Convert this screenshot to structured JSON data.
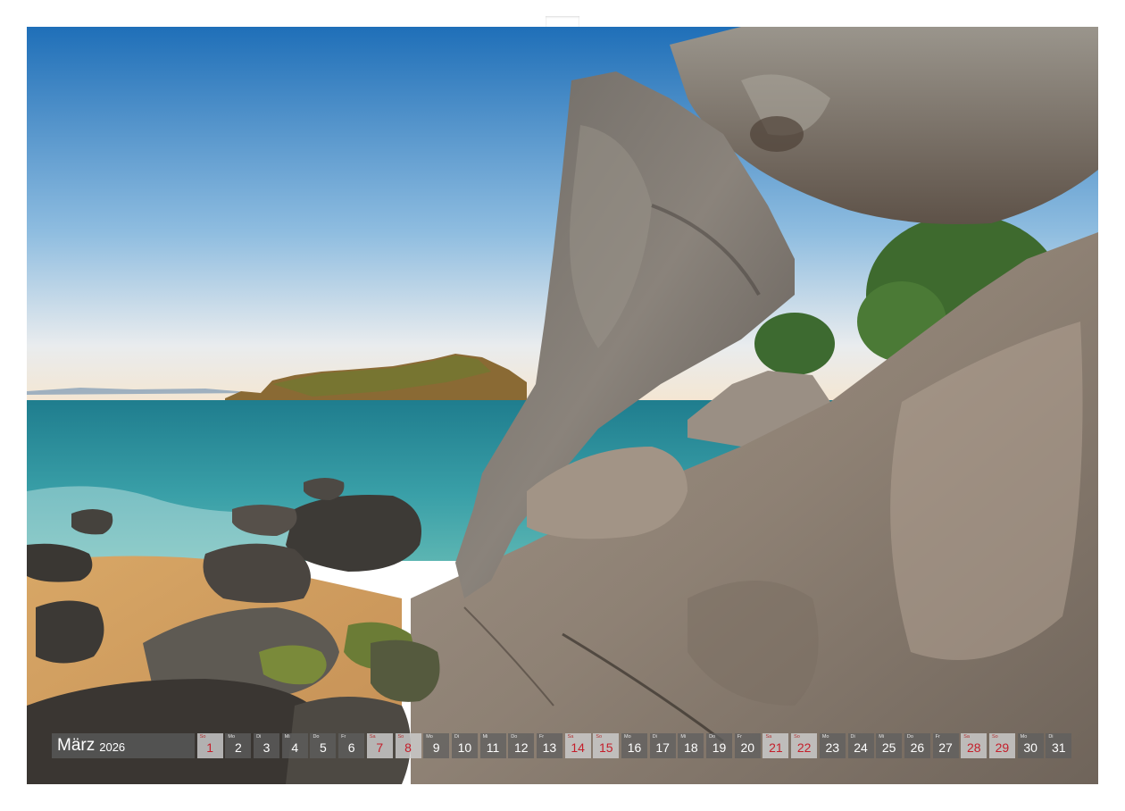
{
  "calendar": {
    "month": "März",
    "year": "2026",
    "days": [
      {
        "wd": "So",
        "num": "1",
        "hol": true
      },
      {
        "wd": "Mo",
        "num": "2",
        "hol": false
      },
      {
        "wd": "Di",
        "num": "3",
        "hol": false
      },
      {
        "wd": "Mi",
        "num": "4",
        "hol": false
      },
      {
        "wd": "Do",
        "num": "5",
        "hol": false
      },
      {
        "wd": "Fr",
        "num": "6",
        "hol": false
      },
      {
        "wd": "Sa",
        "num": "7",
        "hol": true
      },
      {
        "wd": "So",
        "num": "8",
        "hol": true
      },
      {
        "wd": "Mo",
        "num": "9",
        "hol": false
      },
      {
        "wd": "Di",
        "num": "10",
        "hol": false
      },
      {
        "wd": "Mi",
        "num": "11",
        "hol": false
      },
      {
        "wd": "Do",
        "num": "12",
        "hol": false
      },
      {
        "wd": "Fr",
        "num": "13",
        "hol": false
      },
      {
        "wd": "Sa",
        "num": "14",
        "hol": true
      },
      {
        "wd": "So",
        "num": "15",
        "hol": true
      },
      {
        "wd": "Mo",
        "num": "16",
        "hol": false
      },
      {
        "wd": "Di",
        "num": "17",
        "hol": false
      },
      {
        "wd": "Mi",
        "num": "18",
        "hol": false
      },
      {
        "wd": "Do",
        "num": "19",
        "hol": false
      },
      {
        "wd": "Fr",
        "num": "20",
        "hol": false
      },
      {
        "wd": "Sa",
        "num": "21",
        "hol": true
      },
      {
        "wd": "So",
        "num": "22",
        "hol": true
      },
      {
        "wd": "Mo",
        "num": "23",
        "hol": false
      },
      {
        "wd": "Di",
        "num": "24",
        "hol": false
      },
      {
        "wd": "Mi",
        "num": "25",
        "hol": false
      },
      {
        "wd": "Do",
        "num": "26",
        "hol": false
      },
      {
        "wd": "Fr",
        "num": "27",
        "hol": false
      },
      {
        "wd": "Sa",
        "num": "28",
        "hol": true
      },
      {
        "wd": "So",
        "num": "29",
        "hol": true
      },
      {
        "wd": "Mo",
        "num": "30",
        "hol": false
      },
      {
        "wd": "Di",
        "num": "31",
        "hol": false
      }
    ]
  },
  "colors": {
    "weekend_text": "#c41e2a",
    "sky_top": "#1f6fb8",
    "sea": "#2f8f9a",
    "sand": "#d9a865",
    "rock": "#8a7d70"
  }
}
